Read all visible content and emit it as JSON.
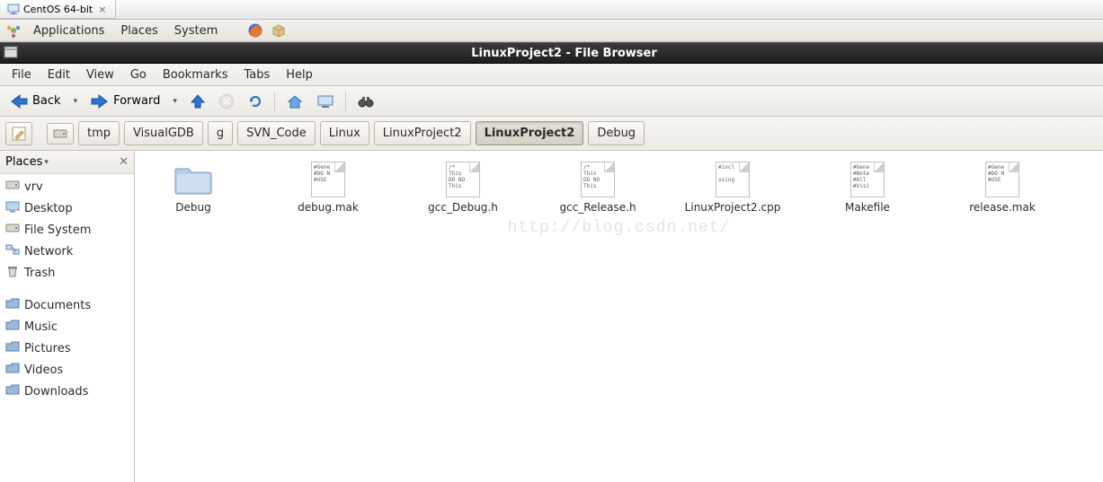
{
  "vm_tab": {
    "label": "CentOS 64-bit"
  },
  "gnome_panel": {
    "menus": [
      "Applications",
      "Places",
      "System"
    ]
  },
  "window": {
    "title": "LinuxProject2 - File Browser"
  },
  "menubar": [
    "File",
    "Edit",
    "View",
    "Go",
    "Bookmarks",
    "Tabs",
    "Help"
  ],
  "toolbar": {
    "back": "Back",
    "forward": "Forward"
  },
  "pathbar": {
    "segments": [
      "tmp",
      "VisualGDB",
      "g",
      "SVN_Code",
      "Linux",
      "LinuxProject2",
      "LinuxProject2",
      "Debug"
    ],
    "active_index": 6
  },
  "sidebar": {
    "header": "Places",
    "items_top": [
      {
        "label": "vrv",
        "icon": "drive"
      },
      {
        "label": "Desktop",
        "icon": "desktop"
      },
      {
        "label": "File System",
        "icon": "drive"
      },
      {
        "label": "Network",
        "icon": "network"
      },
      {
        "label": "Trash",
        "icon": "trash"
      }
    ],
    "items_bottom": [
      {
        "label": "Documents",
        "icon": "folder"
      },
      {
        "label": "Music",
        "icon": "folder"
      },
      {
        "label": "Pictures",
        "icon": "folder"
      },
      {
        "label": "Videos",
        "icon": "folder"
      },
      {
        "label": "Downloads",
        "icon": "folder"
      }
    ]
  },
  "files": [
    {
      "name": "Debug",
      "type": "folder"
    },
    {
      "name": "debug.mak",
      "type": "text",
      "preview": "#Gene\n#DO N\n#USE"
    },
    {
      "name": "gcc_Debug.h",
      "type": "text",
      "preview": "/*\nThis\nDO NO\nThis"
    },
    {
      "name": "gcc_Release.h",
      "type": "text",
      "preview": "/*\nThis\nDO NO\nThis"
    },
    {
      "name": "LinuxProject2.cpp",
      "type": "text",
      "preview": "#incl\n\nusing"
    },
    {
      "name": "Makefile",
      "type": "text",
      "preview": "#Gene\n#Note\n#All\n#Visi"
    },
    {
      "name": "release.mak",
      "type": "text",
      "preview": "#Gene\n#DO N\n#USE"
    }
  ],
  "watermark": "http://blog.csdn.net/"
}
